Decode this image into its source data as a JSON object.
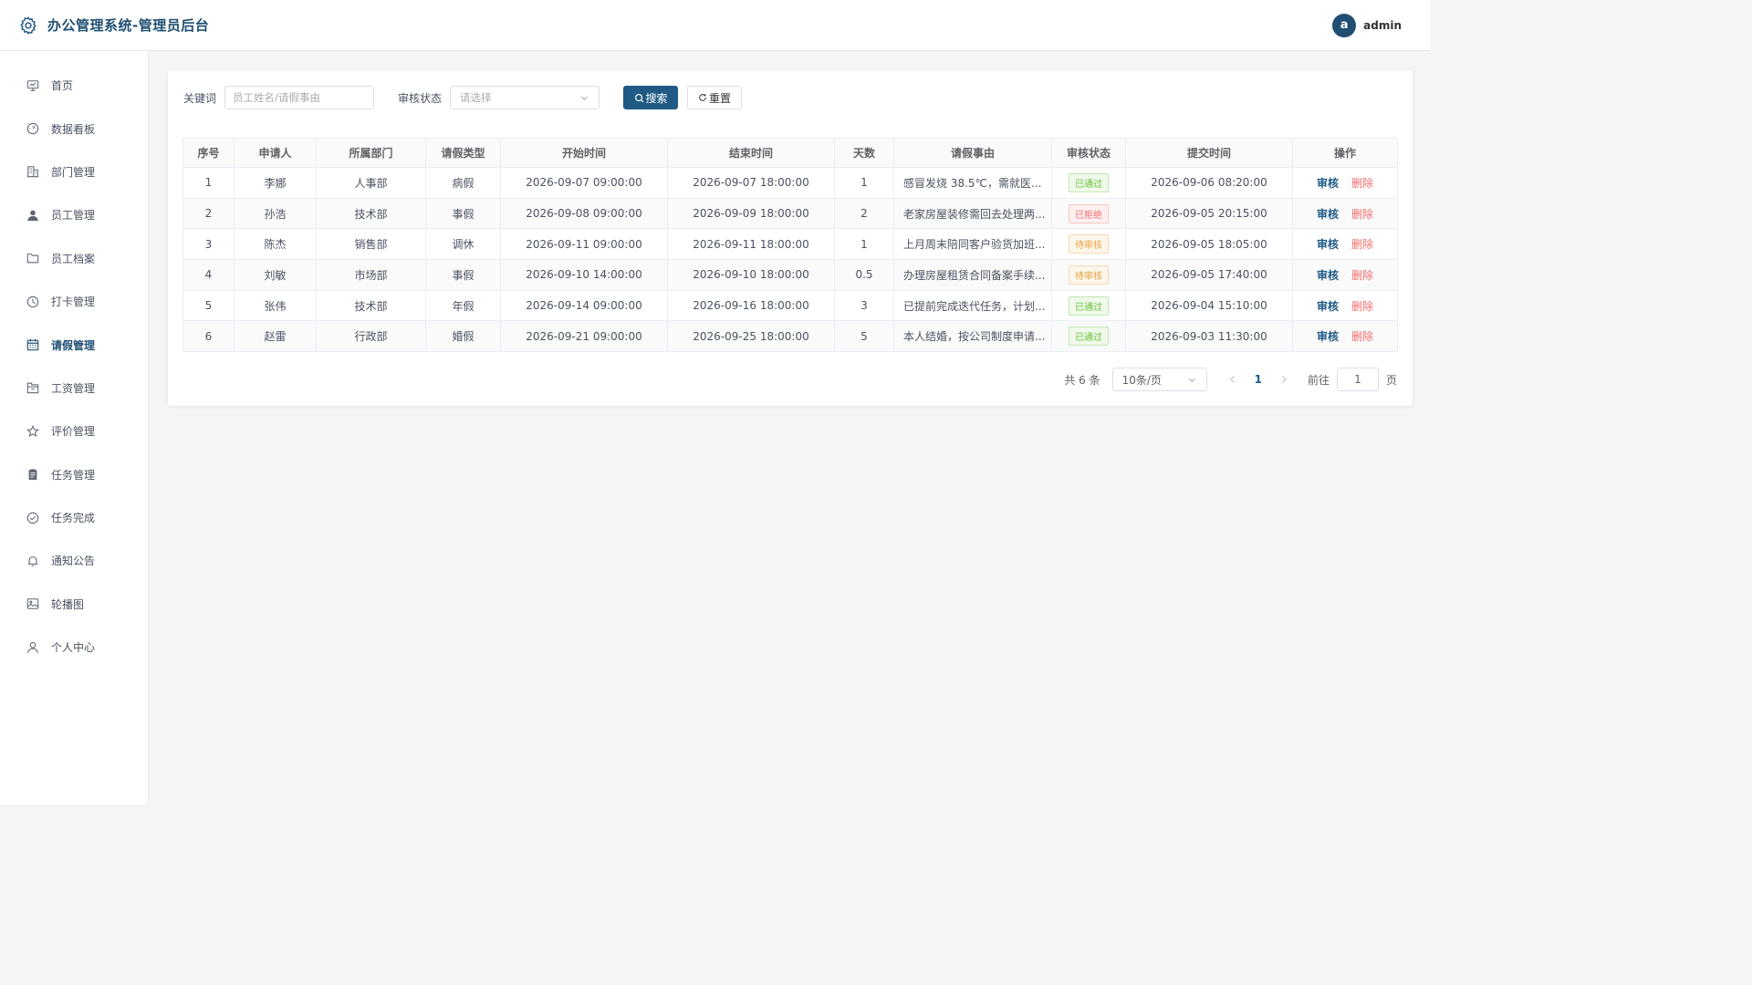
{
  "header": {
    "title": "办公管理系统-管理员后台",
    "avatar_letter": "a",
    "username": "admin"
  },
  "sidebar": {
    "items": [
      {
        "label": "首页",
        "icon": "monitor-icon"
      },
      {
        "label": "数据看板",
        "icon": "dashboard-icon"
      },
      {
        "label": "部门管理",
        "icon": "building-icon"
      },
      {
        "label": "员工管理",
        "icon": "user-filled-icon"
      },
      {
        "label": "员工档案",
        "icon": "folder-icon"
      },
      {
        "label": "打卡管理",
        "icon": "clock-icon"
      },
      {
        "label": "请假管理",
        "icon": "calendar-icon",
        "active": true
      },
      {
        "label": "工资管理",
        "icon": "briefcase-icon"
      },
      {
        "label": "评价管理",
        "icon": "star-icon"
      },
      {
        "label": "任务管理",
        "icon": "clipboard-icon"
      },
      {
        "label": "任务完成",
        "icon": "circle-check-icon"
      },
      {
        "label": "通知公告",
        "icon": "bell-icon"
      },
      {
        "label": "轮播图",
        "icon": "picture-icon"
      },
      {
        "label": "个人中心",
        "icon": "user-icon"
      }
    ]
  },
  "search": {
    "keyword_label": "关键词",
    "keyword_placeholder": "员工姓名/请假事由",
    "status_label": "审核状态",
    "status_placeholder": "请选择",
    "search_button": "搜索",
    "reset_button": "重置"
  },
  "table": {
    "columns": [
      "序号",
      "申请人",
      "所属部门",
      "请假类型",
      "开始时间",
      "结束时间",
      "天数",
      "请假事由",
      "审核状态",
      "提交时间",
      "操作"
    ],
    "rows": [
      {
        "no": "1",
        "applicant": "李娜",
        "dept": "人事部",
        "type": "病假",
        "start": "2026-09-07 09:00:00",
        "end": "2026-09-07 18:00:00",
        "days": "1",
        "reason": "感冒发烧 38.5℃，需就医...",
        "status": "已通过",
        "status_kind": "pass",
        "submitted": "2026-09-06 08:20:00"
      },
      {
        "no": "2",
        "applicant": "孙浩",
        "dept": "技术部",
        "type": "事假",
        "start": "2026-09-08 09:00:00",
        "end": "2026-09-09 18:00:00",
        "days": "2",
        "reason": "老家房屋装修需回去处理两...",
        "status": "已拒绝",
        "status_kind": "reject",
        "submitted": "2026-09-05 20:15:00"
      },
      {
        "no": "3",
        "applicant": "陈杰",
        "dept": "销售部",
        "type": "调休",
        "start": "2026-09-11 09:00:00",
        "end": "2026-09-11 18:00:00",
        "days": "1",
        "reason": "上月周末陪同客户验货加班...",
        "status": "待审核",
        "status_kind": "pending",
        "submitted": "2026-09-05 18:05:00"
      },
      {
        "no": "4",
        "applicant": "刘敏",
        "dept": "市场部",
        "type": "事假",
        "start": "2026-09-10 14:00:00",
        "end": "2026-09-10 18:00:00",
        "days": "0.5",
        "reason": "办理房屋租赁合同备案手续...",
        "status": "待审核",
        "status_kind": "pending",
        "submitted": "2026-09-05 17:40:00"
      },
      {
        "no": "5",
        "applicant": "张伟",
        "dept": "技术部",
        "type": "年假",
        "start": "2026-09-14 09:00:00",
        "end": "2026-09-16 18:00:00",
        "days": "3",
        "reason": "已提前完成迭代任务，计划...",
        "status": "已通过",
        "status_kind": "pass",
        "submitted": "2026-09-04 15:10:00"
      },
      {
        "no": "6",
        "applicant": "赵雷",
        "dept": "行政部",
        "type": "婚假",
        "start": "2026-09-21 09:00:00",
        "end": "2026-09-25 18:00:00",
        "days": "5",
        "reason": "本人结婚，按公司制度申请...",
        "status": "已通过",
        "status_kind": "pass",
        "submitted": "2026-09-03 11:30:00"
      }
    ],
    "actions": {
      "audit": "审核",
      "delete": "删除"
    }
  },
  "pagination": {
    "total_text": "共 6 条",
    "page_size": "10条/页",
    "current_page": "1",
    "goto_label": "前往",
    "goto_value": "1",
    "page_unit": "页"
  },
  "colors": {
    "primary": "#1f5a85",
    "pass": "#67c23a",
    "reject": "#f56c6c",
    "pending": "#e6a23c"
  }
}
